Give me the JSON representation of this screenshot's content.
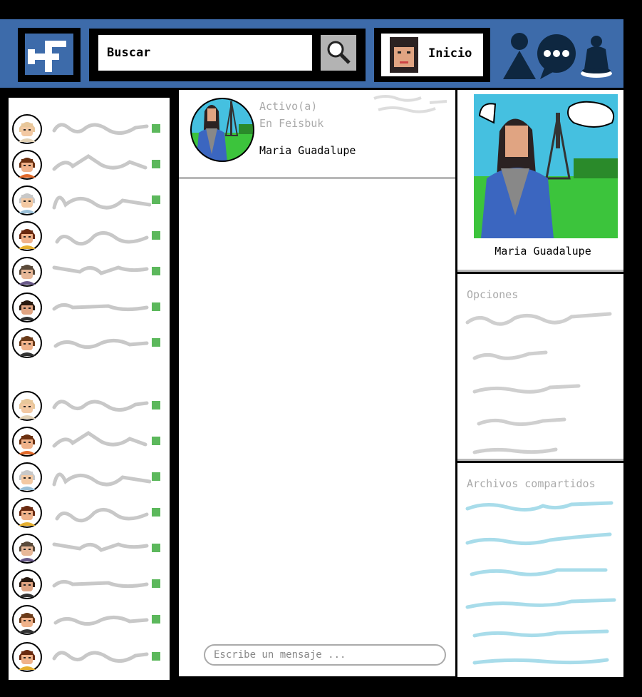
{
  "header": {
    "search_placeholder": "Buscar",
    "home_label": "Inicio",
    "icons": [
      "logo-icon",
      "search-icon",
      "friends-icon",
      "messages-icon",
      "notifications-icon"
    ],
    "colors": {
      "bar": "#3d6baa",
      "online": "#5cb85c"
    }
  },
  "sidebar": {
    "friends": [
      {
        "avatar": "blonde"
      },
      {
        "avatar": "pigtails"
      },
      {
        "avatar": "grandma"
      },
      {
        "avatar": "redhead"
      },
      {
        "avatar": "longhair"
      },
      {
        "avatar": "darkhair"
      },
      {
        "avatar": "brownboy"
      },
      {
        "avatar": "blonde"
      },
      {
        "avatar": "pigtails"
      },
      {
        "avatar": "grandma"
      },
      {
        "avatar": "redhead"
      },
      {
        "avatar": "longhair"
      },
      {
        "avatar": "darkhair"
      },
      {
        "avatar": "brownboy"
      },
      {
        "avatar": "redhead"
      }
    ]
  },
  "chat": {
    "status_line1": "Activo(a)",
    "status_line2": "En Feisbuk",
    "contact_name": "Maria Guadalupe",
    "message_placeholder": "Escribe un mensaje ..."
  },
  "profile": {
    "name": "Maria Guadalupe"
  },
  "options": {
    "title": "Opciones"
  },
  "files": {
    "title": "Archivos compartidos"
  }
}
